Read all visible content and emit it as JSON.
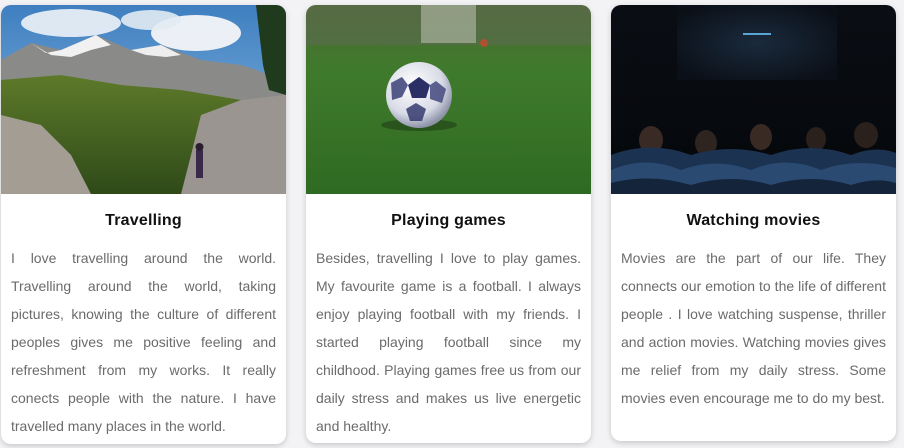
{
  "cards": [
    {
      "title": "Travelling",
      "text": "I love travelling around the world. Travelling around the world, taking pictures, knowing the culture of different peoples gives me positive feeling and refreshment from my works. It really conects people with the nature. I have travelled many places in the world.",
      "image": "mountain-landscape-photo"
    },
    {
      "title": "Playing games",
      "text": "Besides, travelling I love to play games. My favourite game is a football. I always enjoy playing football with my friends. I started playing football since my childhood. Playing games free us from our daily stress and makes us live energetic and healthy.",
      "image": "football-on-grass-photo"
    },
    {
      "title": "Watching movies",
      "text": "Movies are the part of our life. They connects our emotion to the life of different people . I love watching suspense, thriller and action movies. Watching movies gives me relief from my daily stress. Some movies even encourage me to do my best.",
      "image": "cinema-audience-photo"
    }
  ],
  "colors": {
    "page_background": "#f3f3f5",
    "card_background": "#ffffff",
    "title_color": "#111111",
    "text_color": "#6b6b6b"
  }
}
